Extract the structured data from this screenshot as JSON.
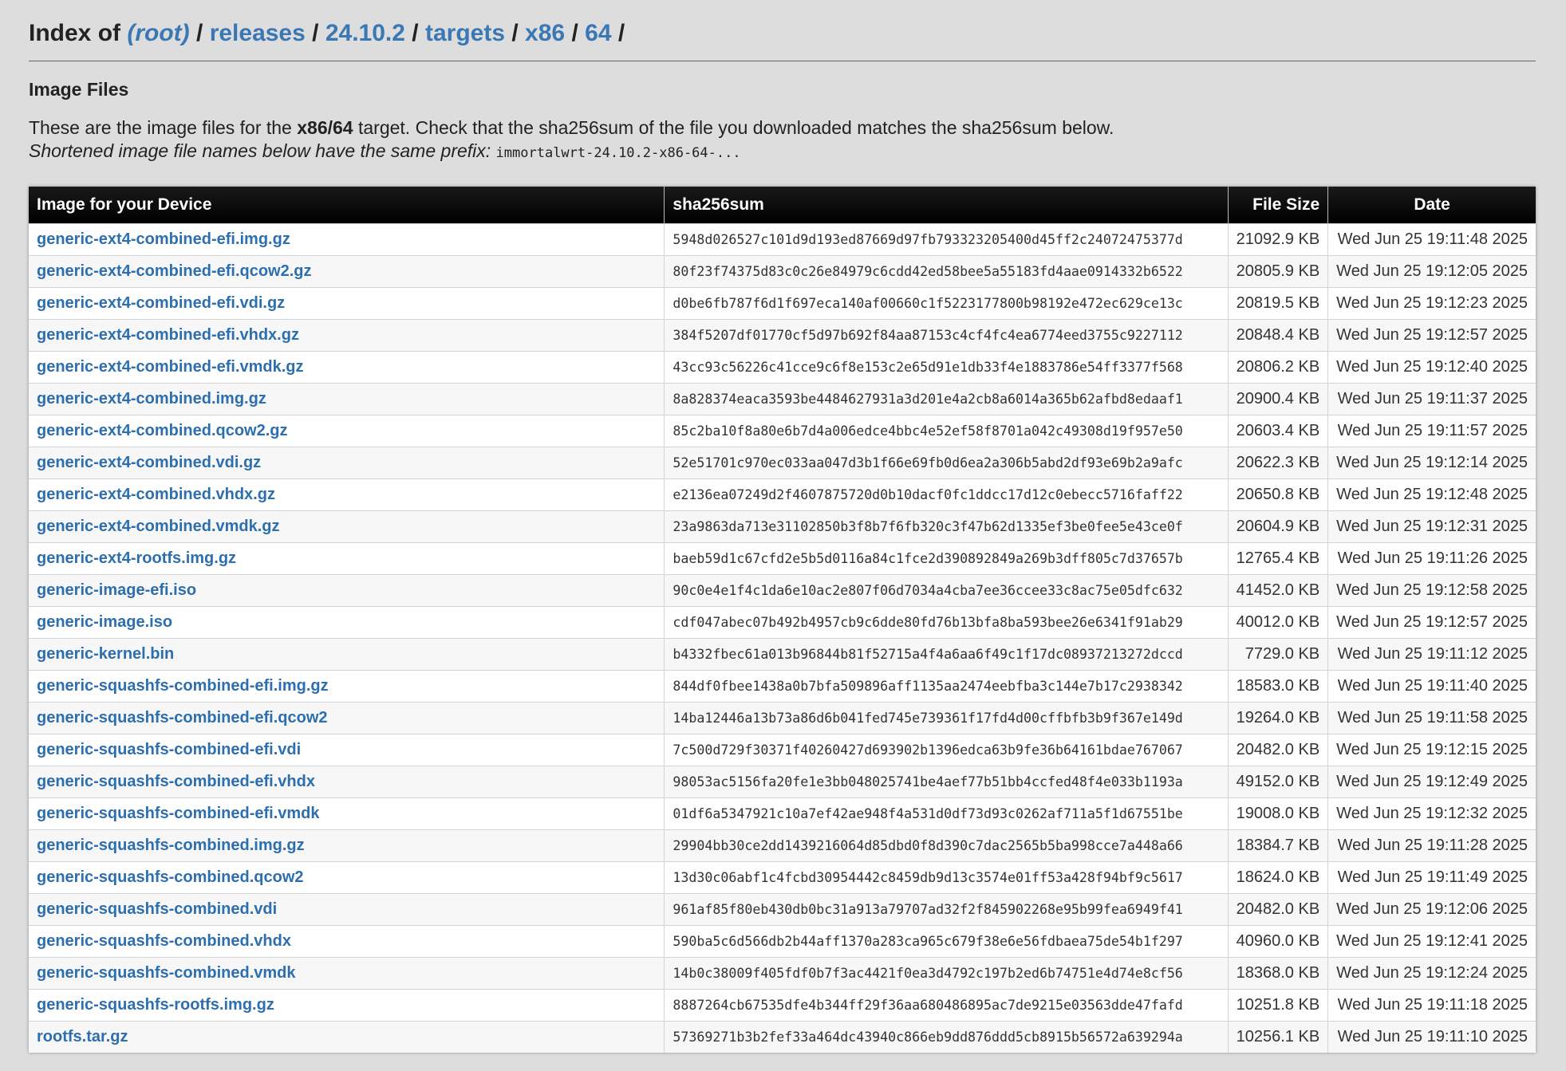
{
  "breadcrumb": {
    "prefix": "Index of",
    "root": "(root)",
    "parts": [
      "releases",
      "24.10.2",
      "targets",
      "x86",
      "64"
    ],
    "separator": "/"
  },
  "section_title": "Image Files",
  "description": {
    "part1": "These are the image files for the",
    "target": "x86/64",
    "part2": "target. Check that the sha256sum of the file you downloaded matches the sha256sum below.",
    "prefix_text": "Shortened image file names below have the same prefix:",
    "prefix_code": "immortalwrt-24.10.2-x86-64-..."
  },
  "table": {
    "headers": [
      "Image for your Device",
      "sha256sum",
      "File Size",
      "Date"
    ],
    "rows": [
      {
        "name": "generic-ext4-combined-efi.img.gz",
        "sha": "5948d026527c101d9d193ed87669d97fb793323205400d45ff2c24072475377d",
        "size": "21092.9 KB",
        "date": "Wed Jun 25 19:11:48 2025"
      },
      {
        "name": "generic-ext4-combined-efi.qcow2.gz",
        "sha": "80f23f74375d83c0c26e84979c6cdd42ed58bee5a55183fd4aae0914332b6522",
        "size": "20805.9 KB",
        "date": "Wed Jun 25 19:12:05 2025"
      },
      {
        "name": "generic-ext4-combined-efi.vdi.gz",
        "sha": "d0be6fb787f6d1f697eca140af00660c1f5223177800b98192e472ec629ce13c",
        "size": "20819.5 KB",
        "date": "Wed Jun 25 19:12:23 2025"
      },
      {
        "name": "generic-ext4-combined-efi.vhdx.gz",
        "sha": "384f5207df01770cf5d97b692f84aa87153c4cf4fc4ea6774eed3755c9227112",
        "size": "20848.4 KB",
        "date": "Wed Jun 25 19:12:57 2025"
      },
      {
        "name": "generic-ext4-combined-efi.vmdk.gz",
        "sha": "43cc93c56226c41cce9c6f8e153c2e65d91e1db33f4e1883786e54ff3377f568",
        "size": "20806.2 KB",
        "date": "Wed Jun 25 19:12:40 2025"
      },
      {
        "name": "generic-ext4-combined.img.gz",
        "sha": "8a828374eaca3593be4484627931a3d201e4a2cb8a6014a365b62afbd8edaaf1",
        "size": "20900.4 KB",
        "date": "Wed Jun 25 19:11:37 2025"
      },
      {
        "name": "generic-ext4-combined.qcow2.gz",
        "sha": "85c2ba10f8a80e6b7d4a006edce4bbc4e52ef58f8701a042c49308d19f957e50",
        "size": "20603.4 KB",
        "date": "Wed Jun 25 19:11:57 2025"
      },
      {
        "name": "generic-ext4-combined.vdi.gz",
        "sha": "52e51701c970ec033aa047d3b1f66e69fb0d6ea2a306b5abd2df93e69b2a9afc",
        "size": "20622.3 KB",
        "date": "Wed Jun 25 19:12:14 2025"
      },
      {
        "name": "generic-ext4-combined.vhdx.gz",
        "sha": "e2136ea07249d2f4607875720d0b10dacf0fc1ddcc17d12c0ebecc5716faff22",
        "size": "20650.8 KB",
        "date": "Wed Jun 25 19:12:48 2025"
      },
      {
        "name": "generic-ext4-combined.vmdk.gz",
        "sha": "23a9863da713e31102850b3f8b7f6fb320c3f47b62d1335ef3be0fee5e43ce0f",
        "size": "20604.9 KB",
        "date": "Wed Jun 25 19:12:31 2025"
      },
      {
        "name": "generic-ext4-rootfs.img.gz",
        "sha": "baeb59d1c67cfd2e5b5d0116a84c1fce2d390892849a269b3dff805c7d37657b",
        "size": "12765.4 KB",
        "date": "Wed Jun 25 19:11:26 2025"
      },
      {
        "name": "generic-image-efi.iso",
        "sha": "90c0e4e1f4c1da6e10ac2e807f06d7034a4cba7ee36ccee33c8ac75e05dfc632",
        "size": "41452.0 KB",
        "date": "Wed Jun 25 19:12:58 2025"
      },
      {
        "name": "generic-image.iso",
        "sha": "cdf047abec07b492b4957cb9c6dde80fd76b13bfa8ba593bee26e6341f91ab29",
        "size": "40012.0 KB",
        "date": "Wed Jun 25 19:12:57 2025"
      },
      {
        "name": "generic-kernel.bin",
        "sha": "b4332fbec61a013b96844b81f52715a4f4a6aa6f49c1f17dc08937213272dccd",
        "size": "7729.0 KB",
        "date": "Wed Jun 25 19:11:12 2025"
      },
      {
        "name": "generic-squashfs-combined-efi.img.gz",
        "sha": "844df0fbee1438a0b7bfa509896aff1135aa2474eebfba3c144e7b17c2938342",
        "size": "18583.0 KB",
        "date": "Wed Jun 25 19:11:40 2025"
      },
      {
        "name": "generic-squashfs-combined-efi.qcow2",
        "sha": "14ba12446a13b73a86d6b041fed745e739361f17fd4d00cffbfb3b9f367e149d",
        "size": "19264.0 KB",
        "date": "Wed Jun 25 19:11:58 2025"
      },
      {
        "name": "generic-squashfs-combined-efi.vdi",
        "sha": "7c500d729f30371f40260427d693902b1396edca63b9fe36b64161bdae767067",
        "size": "20482.0 KB",
        "date": "Wed Jun 25 19:12:15 2025"
      },
      {
        "name": "generic-squashfs-combined-efi.vhdx",
        "sha": "98053ac5156fa20fe1e3bb048025741be4aef77b51bb4ccfed48f4e033b1193a",
        "size": "49152.0 KB",
        "date": "Wed Jun 25 19:12:49 2025"
      },
      {
        "name": "generic-squashfs-combined-efi.vmdk",
        "sha": "01df6a5347921c10a7ef42ae948f4a531d0df73d93c0262af711a5f1d67551be",
        "size": "19008.0 KB",
        "date": "Wed Jun 25 19:12:32 2025"
      },
      {
        "name": "generic-squashfs-combined.img.gz",
        "sha": "29904bb30ce2dd1439216064d85dbd0f8d390c7dac2565b5ba998cce7a448a66",
        "size": "18384.7 KB",
        "date": "Wed Jun 25 19:11:28 2025"
      },
      {
        "name": "generic-squashfs-combined.qcow2",
        "sha": "13d30c06abf1c4fcbd30954442c8459db9d13c3574e01ff53a428f94bf9c5617",
        "size": "18624.0 KB",
        "date": "Wed Jun 25 19:11:49 2025"
      },
      {
        "name": "generic-squashfs-combined.vdi",
        "sha": "961af85f80eb430db0bc31a913a79707ad32f2f845902268e95b99fea6949f41",
        "size": "20482.0 KB",
        "date": "Wed Jun 25 19:12:06 2025"
      },
      {
        "name": "generic-squashfs-combined.vhdx",
        "sha": "590ba5c6d566db2b44aff1370a283ca965c679f38e6e56fdbaea75de54b1f297",
        "size": "40960.0 KB",
        "date": "Wed Jun 25 19:12:41 2025"
      },
      {
        "name": "generic-squashfs-combined.vmdk",
        "sha": "14b0c38009f405fdf0b7f3ac4421f0ea3d4792c197b2ed6b74751e4d74e8cf56",
        "size": "18368.0 KB",
        "date": "Wed Jun 25 19:12:24 2025"
      },
      {
        "name": "generic-squashfs-rootfs.img.gz",
        "sha": "8887264cb67535dfe4b344ff29f36aa680486895ac7de9215e03563dde47fafd",
        "size": "10251.8 KB",
        "date": "Wed Jun 25 19:11:18 2025"
      },
      {
        "name": "rootfs.tar.gz",
        "sha": "57369271b3b2fef33a464dc43940c866eb9dd876ddd5cb8915b56572a639294a",
        "size": "10256.1 KB",
        "date": "Wed Jun 25 19:11:10 2025"
      }
    ]
  },
  "colors": {
    "link": "#2d6fae",
    "background": "#dddddd",
    "header_bg": "#000000"
  }
}
